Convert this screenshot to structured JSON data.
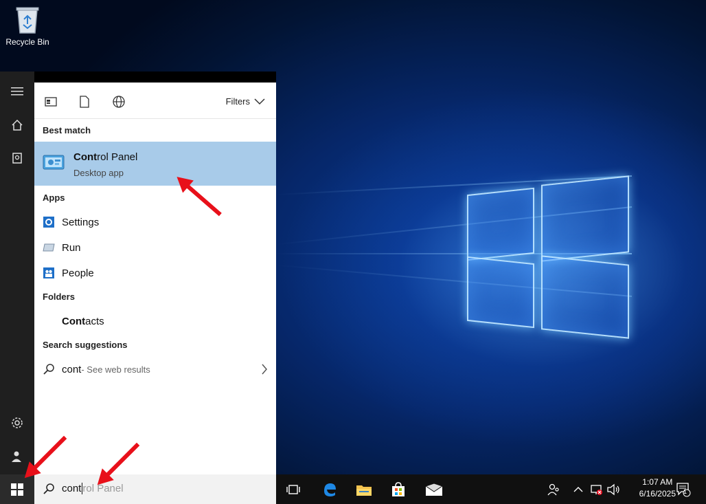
{
  "desktop": {
    "recycle_bin_label": "Recycle Bin"
  },
  "panel": {
    "filters_label": "Filters",
    "best_match_header": "Best match",
    "best_match": {
      "title_bold": "Cont",
      "title_rest": "rol Panel",
      "subtitle": "Desktop app"
    },
    "apps_header": "Apps",
    "apps": [
      {
        "label": "Settings",
        "icon": "gear-icon"
      },
      {
        "label": "Run",
        "icon": "run-icon"
      },
      {
        "label": "People",
        "icon": "people-icon"
      }
    ],
    "folders_header": "Folders",
    "folders": [
      {
        "label_bold": "Cont",
        "label_rest": "acts"
      }
    ],
    "suggestions_header": "Search suggestions",
    "suggestion": {
      "query": "cont",
      "suffix": " - See web results"
    }
  },
  "search": {
    "typed": "cont",
    "ghost": "rol Panel"
  },
  "clock": {
    "time": "1:07 AM",
    "date": "6/16/2025"
  },
  "notification_count": "1",
  "colors": {
    "highlight": "#a8cbe9",
    "arrow": "#e8101a",
    "rail": "#1f1f1f",
    "taskbar": "#101010"
  }
}
